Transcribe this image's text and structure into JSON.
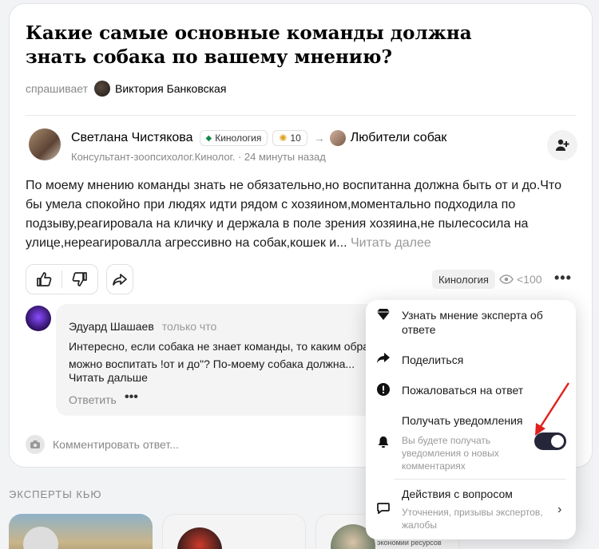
{
  "question": {
    "title": "Какие самые основные команды должна знать собака по вашему мнению?",
    "asked_label": "спрашивает",
    "asker": "Виктория Банковская"
  },
  "answer": {
    "author": "Светлана Чистякова",
    "topic_badge": "Кинология",
    "score": "10",
    "group": "Любители собак",
    "subtitle": "Консультант-зоопсихолог.Кинолог. · 24 минуты назад",
    "text": "По моему мнению команды знать не обязательно,но воспитанна должна быть от и до.Что бы умела спокойно при людях идти рядом с хозяином,моментально подходила по подзыву,реагировала на кличку и держала в поле зрения хозяина,не пылесосила на улице,нереагировалла агрессивно на собак,кошек и...",
    "read_more": "Читать далее",
    "tag": "Кинология",
    "views": "<100"
  },
  "comment": {
    "author": "Эдуард Шашаев",
    "time": "только что",
    "line1": "Интересно, если собака не знает команды, то каким обра",
    "line2": "можно воспитать !от и до\"? По-моему собака должна...",
    "read_more": "Читать дальше",
    "reply": "Ответить"
  },
  "comment_input": {
    "placeholder": "Комментировать ответ..."
  },
  "experts": {
    "title": "ЭКСПЕРТЫ КЬЮ",
    "card3_caption": "экономии ресурсов"
  },
  "menu": {
    "expert": "Узнать мнение эксперта об ответе",
    "share": "Поделиться",
    "report": "Пожаловаться на ответ",
    "notify": "Получать уведомления",
    "notify_sub": "Вы будете получать уведомления о новых комментариях",
    "notify_on": true,
    "actions": "Действия с вопросом",
    "actions_sub": "Уточнения, призывы экспертов, жалобы"
  },
  "colors": {
    "toggle": "#26263a",
    "annotation_arrow": "#e0201c",
    "badge_gem": "#138a4a"
  }
}
